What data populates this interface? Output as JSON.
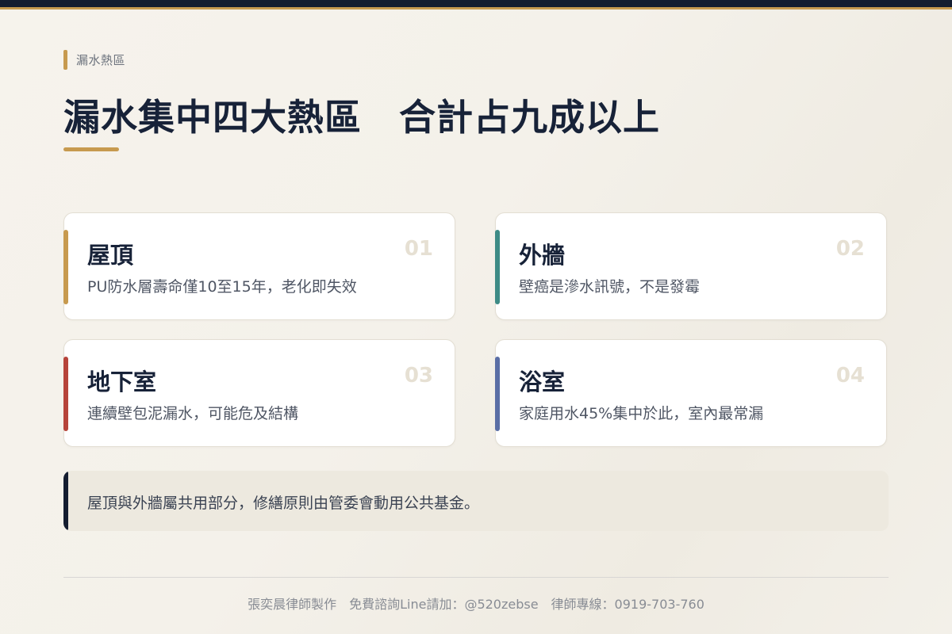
{
  "eyebrow": "漏水熱區",
  "title": "漏水集中四大熱區　合計占九成以上",
  "cards": [
    {
      "title": "屋頂",
      "desc": "PU防水層壽命僅10至15年，老化即失效",
      "num": "01",
      "accent": "#c79a4f"
    },
    {
      "title": "外牆",
      "desc": "壁癌是滲水訊號，不是發霉",
      "num": "02",
      "accent": "#3d8b86"
    },
    {
      "title": "地下室",
      "desc": "連續壁包泥漏水，可能危及結構",
      "num": "03",
      "accent": "#b6443a"
    },
    {
      "title": "浴室",
      "desc": "家庭用水45%集中於此，室內最常漏",
      "num": "04",
      "accent": "#5a6ea5"
    }
  ],
  "note": "屋頂與外牆屬共用部分，修繕原則由管委會動用公共基金。",
  "footer": "張奕晨律師製作　免費諮詢Line請加：@520zebse　律師專線：0919-703-760",
  "colors": {
    "gold": "#c79a4f",
    "navy": "#141d30"
  }
}
